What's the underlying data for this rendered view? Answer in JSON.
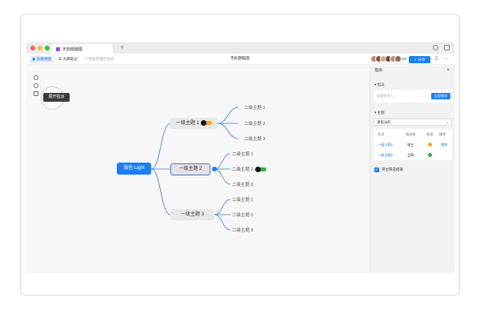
{
  "tab": {
    "title": "无标题脑图",
    "plus": "+"
  },
  "toolbar": {
    "mindmap_label": "思维导图",
    "outline_label": "大纲笔记",
    "hint_label": "添加到最近访问",
    "doc_title": "无标题脑图",
    "collab_count": "99",
    "share_label": "分享"
  },
  "tooltip": {
    "text": "展开指派"
  },
  "mindmap": {
    "root": "浅色 Light",
    "branches": [
      {
        "label": "一级主题 1",
        "children": [
          "二级主题 1",
          "二级主题 2",
          "二级主题 3"
        ]
      },
      {
        "label": "一级主题 2",
        "children": [
          "二级主题 1",
          "二级主题 2",
          "二级主题 3"
        ]
      },
      {
        "label": "一级主题 3",
        "children": [
          "二级主题 1",
          "二级主题 2",
          "二级主题 3"
        ]
      }
    ]
  },
  "panel": {
    "title": "指派",
    "close": "×",
    "section_assign": "指派",
    "assign_placeholder": "添加关系人",
    "assign_button": "立即指派",
    "section_filter": "主题",
    "filter_select": "查指派的",
    "table": {
      "headers": [
        "节点",
        "指派给",
        "状态",
        "操作"
      ],
      "rows": [
        {
          "node": "一级主题1",
          "assignee": "张三",
          "action": "通知"
        },
        {
          "node": "一级主题2",
          "assignee": "王四",
          "action": ""
        }
      ]
    },
    "checkbox_label": "突出筛选结果"
  },
  "colors": {
    "accent": "#1d7ef3",
    "status_pending": "#f5a623",
    "status_done": "#2bb24c"
  }
}
